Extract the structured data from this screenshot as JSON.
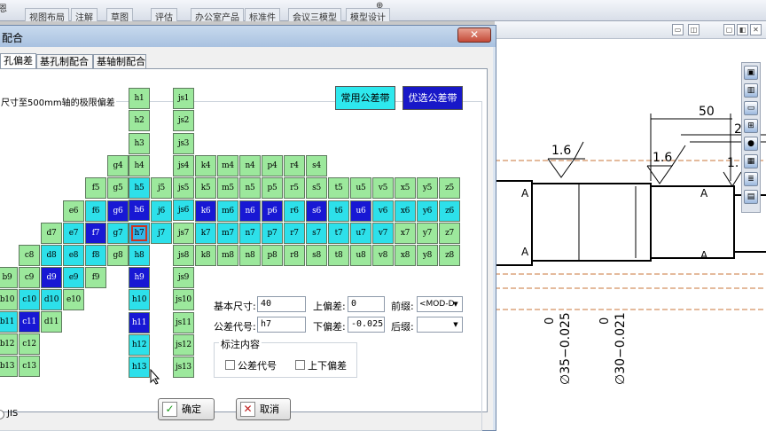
{
  "ribbon": {
    "tabs": [
      "视图布局",
      "注解",
      "草图",
      "评估",
      "办公室产品",
      "标准件",
      "会议三模型",
      "模型设计"
    ],
    "top_fragments": [
      "恩",
      "⊕"
    ]
  },
  "dialog": {
    "title": "配合",
    "close": "✕",
    "tabs": [
      "孔偏差",
      "基孔制配合",
      "基轴制配合"
    ],
    "group_title": "尺寸至500mm轴的极限偏差",
    "btn_common": "常用公差带",
    "btn_preferred": "优选公差带",
    "grid_cells": [
      {
        "t": "h1",
        "c": "g"
      },
      {
        "t": "h2",
        "c": "g"
      },
      {
        "t": "h3",
        "c": "g"
      },
      {
        "t": "h4",
        "c": "g"
      },
      {
        "t": "h5",
        "c": "c"
      },
      {
        "t": "h6",
        "c": "d"
      },
      {
        "t": "h7",
        "c": "s"
      },
      {
        "t": "h8",
        "c": "c"
      },
      {
        "t": "h9",
        "c": "d"
      },
      {
        "t": "h10",
        "c": "c"
      },
      {
        "t": "h11",
        "c": "d"
      },
      {
        "t": "h12",
        "c": "c"
      },
      {
        "t": "h13",
        "c": "c"
      },
      {
        "t": "js1",
        "c": "g"
      },
      {
        "t": "js2",
        "c": "g"
      },
      {
        "t": "js3",
        "c": "g"
      },
      {
        "t": "js4",
        "c": "g"
      },
      {
        "t": "js5",
        "c": "g"
      },
      {
        "t": "js6",
        "c": "c"
      },
      {
        "t": "js7",
        "c": "g"
      },
      {
        "t": "js8",
        "c": "g"
      },
      {
        "t": "js9",
        "c": "g"
      },
      {
        "t": "js10",
        "c": "g"
      },
      {
        "t": "js11",
        "c": "g"
      },
      {
        "t": "js12",
        "c": "g"
      },
      {
        "t": "js13",
        "c": "g"
      },
      {
        "t": "g4",
        "c": "g"
      },
      {
        "t": "k4",
        "c": "g"
      },
      {
        "t": "m4",
        "c": "g"
      },
      {
        "t": "n4",
        "c": "g"
      },
      {
        "t": "p4",
        "c": "g"
      },
      {
        "t": "r4",
        "c": "g"
      },
      {
        "t": "s4",
        "c": "g"
      },
      {
        "t": "f5",
        "c": "g"
      },
      {
        "t": "g5",
        "c": "g"
      },
      {
        "t": "j5",
        "c": "g"
      },
      {
        "t": "k5",
        "c": "g"
      },
      {
        "t": "m5",
        "c": "g"
      },
      {
        "t": "n5",
        "c": "g"
      },
      {
        "t": "p5",
        "c": "g"
      },
      {
        "t": "r5",
        "c": "g"
      },
      {
        "t": "s5",
        "c": "g"
      },
      {
        "t": "t5",
        "c": "g"
      },
      {
        "t": "u5",
        "c": "g"
      },
      {
        "t": "v5",
        "c": "g"
      },
      {
        "t": "x5",
        "c": "g"
      },
      {
        "t": "y5",
        "c": "g"
      },
      {
        "t": "z5",
        "c": "g"
      },
      {
        "t": "e6",
        "c": "g"
      },
      {
        "t": "f6",
        "c": "c"
      },
      {
        "t": "g6",
        "c": "d"
      },
      {
        "t": "j6",
        "c": "c"
      },
      {
        "t": "k6",
        "c": "d"
      },
      {
        "t": "m6",
        "c": "c"
      },
      {
        "t": "n6",
        "c": "d"
      },
      {
        "t": "p6",
        "c": "d"
      },
      {
        "t": "r6",
        "c": "c"
      },
      {
        "t": "s6",
        "c": "d"
      },
      {
        "t": "t6",
        "c": "c"
      },
      {
        "t": "u6",
        "c": "d"
      },
      {
        "t": "v6",
        "c": "c"
      },
      {
        "t": "x6",
        "c": "c"
      },
      {
        "t": "y6",
        "c": "c"
      },
      {
        "t": "z6",
        "c": "c"
      },
      {
        "t": "d7",
        "c": "g"
      },
      {
        "t": "e7",
        "c": "c"
      },
      {
        "t": "f7",
        "c": "d"
      },
      {
        "t": "g7",
        "c": "c"
      },
      {
        "t": "j7",
        "c": "c"
      },
      {
        "t": "k7",
        "c": "c"
      },
      {
        "t": "m7",
        "c": "c"
      },
      {
        "t": "n7",
        "c": "c"
      },
      {
        "t": "p7",
        "c": "c"
      },
      {
        "t": "r7",
        "c": "c"
      },
      {
        "t": "s7",
        "c": "c"
      },
      {
        "t": "t7",
        "c": "c"
      },
      {
        "t": "u7",
        "c": "c"
      },
      {
        "t": "v7",
        "c": "c"
      },
      {
        "t": "x7",
        "c": "g"
      },
      {
        "t": "y7",
        "c": "g"
      },
      {
        "t": "z7",
        "c": "g"
      },
      {
        "t": "c8",
        "c": "g"
      },
      {
        "t": "d8",
        "c": "c"
      },
      {
        "t": "e8",
        "c": "c"
      },
      {
        "t": "f8",
        "c": "c"
      },
      {
        "t": "g8",
        "c": "g"
      },
      {
        "t": "k8",
        "c": "g"
      },
      {
        "t": "m8",
        "c": "g"
      },
      {
        "t": "n8",
        "c": "g"
      },
      {
        "t": "p8",
        "c": "g"
      },
      {
        "t": "r8",
        "c": "g"
      },
      {
        "t": "s8",
        "c": "g"
      },
      {
        "t": "t8",
        "c": "g"
      },
      {
        "t": "u8",
        "c": "g"
      },
      {
        "t": "v8",
        "c": "g"
      },
      {
        "t": "x8",
        "c": "g"
      },
      {
        "t": "y8",
        "c": "g"
      },
      {
        "t": "z8",
        "c": "g"
      },
      {
        "t": "b9",
        "c": "g"
      },
      {
        "t": "c9",
        "c": "g"
      },
      {
        "t": "d9",
        "c": "d"
      },
      {
        "t": "e9",
        "c": "c"
      },
      {
        "t": "f9",
        "c": "g"
      },
      {
        "t": "b10",
        "c": "g"
      },
      {
        "t": "c10",
        "c": "c"
      },
      {
        "t": "d10",
        "c": "c"
      },
      {
        "t": "e10",
        "c": "g"
      },
      {
        "t": "b11",
        "c": "c"
      },
      {
        "t": "c11",
        "c": "d"
      },
      {
        "t": "d11",
        "c": "g"
      },
      {
        "t": "b12",
        "c": "g"
      },
      {
        "t": "c12",
        "c": "g"
      },
      {
        "t": "b13",
        "c": "g"
      },
      {
        "t": "c13",
        "c": "g"
      }
    ],
    "fields": {
      "basic_size_label": "基本尺寸:",
      "basic_size": "40",
      "upper_label": "上偏差:",
      "upper": "0",
      "prefix_label": "前缀:",
      "prefix": "<MOD-D:",
      "code_label": "公差代号:",
      "code": "h7",
      "lower_label": "下偏差:",
      "lower": "-0.025",
      "suffix_label": "后缀:",
      "suffix": ""
    },
    "annotation": {
      "title": "标注内容",
      "opt1": "公差代号",
      "opt2": "上下偏差"
    },
    "jis_label": "JIS",
    "ok": "确定",
    "ok_icon": "✓",
    "cancel": "取消",
    "cancel_icon": "✕"
  },
  "drawing": {
    "dim_50": "50",
    "rough1": "1.6",
    "rough2": "1.6",
    "rough3": "1.",
    "rough4": "2",
    "sec_a1": "A",
    "sec_a2": "A",
    "sec_a3": "A",
    "sec_a4": "A",
    "zero1": "0",
    "zero2": "0",
    "phi35": "∅35−0.025",
    "phi30": "∅30−0.021"
  }
}
